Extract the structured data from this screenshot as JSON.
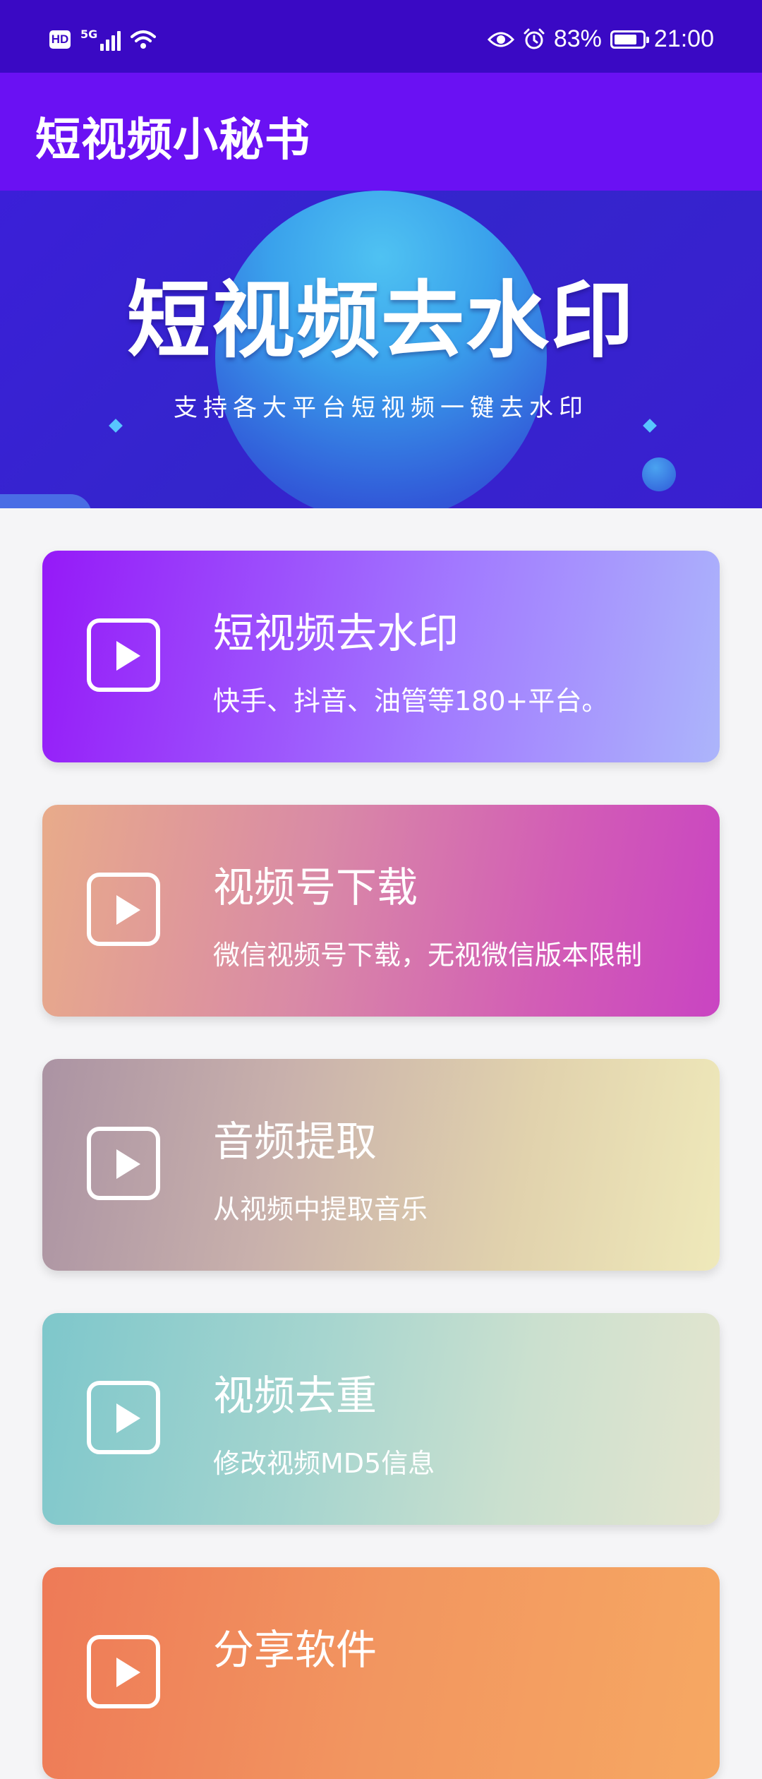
{
  "status_bar": {
    "hd_badge": "HD",
    "network": "5G",
    "battery_percent": "83%",
    "battery_level": 0.83,
    "time": "21:00",
    "icons": [
      "signal-icon",
      "wifi-icon",
      "eye-icon",
      "alarm-icon",
      "battery-icon"
    ]
  },
  "app_bar": {
    "title": "短视频小秘书",
    "color": "#6a11f3"
  },
  "banner": {
    "title": "短视频去水印",
    "subtitle": "支持各大平台短视频一键去水印"
  },
  "features": [
    {
      "title": "短视频去水印",
      "desc": "快手、抖音、油管等180+平台。",
      "icon": "play-icon"
    },
    {
      "title": "视频号下载",
      "desc": "微信视频号下载，无视微信版本限制",
      "icon": "play-icon"
    },
    {
      "title": "音频提取",
      "desc": "从视频中提取音乐",
      "icon": "play-icon"
    },
    {
      "title": "视频去重",
      "desc": "修改视频MD5信息",
      "icon": "play-icon"
    },
    {
      "title": "分享软件",
      "desc": "",
      "icon": "play-icon"
    }
  ]
}
